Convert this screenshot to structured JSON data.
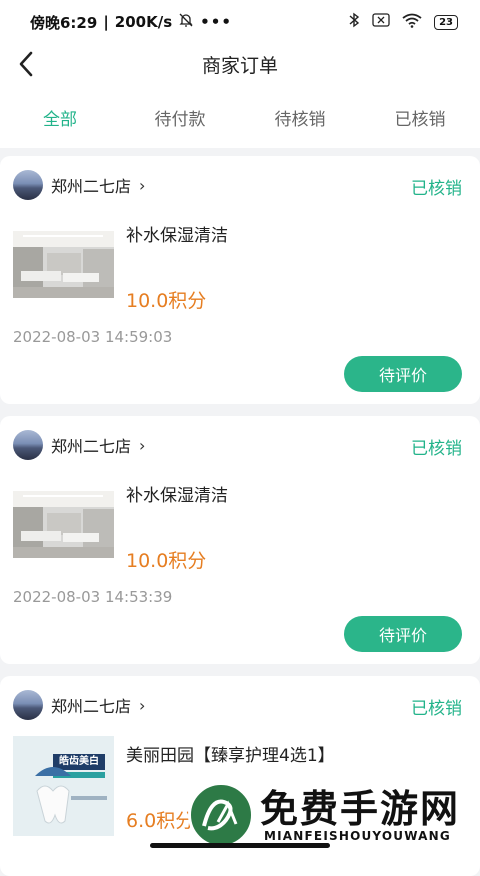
{
  "statusbar": {
    "time": "傍晚6:29",
    "speed": "200K/s",
    "battery": "23"
  },
  "header": {
    "title": "商家订单"
  },
  "tabs": [
    {
      "label": "全部",
      "active": true
    },
    {
      "label": "待付款",
      "active": false
    },
    {
      "label": "待核销",
      "active": false
    },
    {
      "label": "已核销",
      "active": false
    }
  ],
  "orders": [
    {
      "shop": "郑州二七店",
      "status": "已核销",
      "product": "补水保湿清洁",
      "price": "10.0积分",
      "time": "2022-08-03 14:59:03",
      "action": "待评价",
      "image": "salon-room"
    },
    {
      "shop": "郑州二七店",
      "status": "已核销",
      "product": "补水保湿清洁",
      "price": "10.0积分",
      "time": "2022-08-03 14:53:39",
      "action": "待评价",
      "image": "salon-room"
    },
    {
      "shop": "郑州二七店",
      "status": "已核销",
      "product": "美丽田园【臻享护理4选1】",
      "price": "6.0积分",
      "time": "",
      "action": "",
      "image": "teeth-whitening-poster",
      "poster_text": "皓齿美白"
    }
  ],
  "watermark": {
    "title": "免费手游网",
    "subtitle": "MIANFEISHOUYOUWANG"
  },
  "colors": {
    "accent": "#22b38a",
    "price": "#e67e22"
  }
}
